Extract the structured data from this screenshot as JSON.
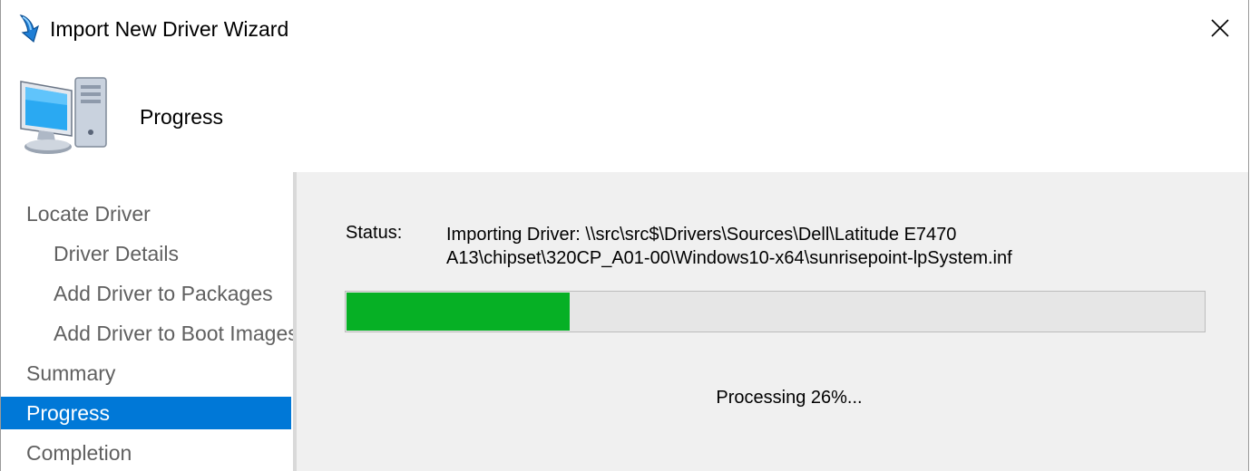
{
  "window": {
    "title": "Import New Driver Wizard",
    "close_label": "Close"
  },
  "header": {
    "title": "Progress"
  },
  "nav": {
    "items": [
      {
        "label": "Locate Driver",
        "level": 0,
        "active": false
      },
      {
        "label": "Driver Details",
        "level": 1,
        "active": false
      },
      {
        "label": "Add Driver to Packages",
        "level": 1,
        "active": false
      },
      {
        "label": "Add Driver to Boot Images",
        "level": 1,
        "active": false
      },
      {
        "label": "Summary",
        "level": 0,
        "active": false
      },
      {
        "label": "Progress",
        "level": 0,
        "active": true
      },
      {
        "label": "Completion",
        "level": 0,
        "active": false
      }
    ]
  },
  "main": {
    "status_label": "Status:",
    "status_line1": "Importing Driver: \\\\src\\src$\\Drivers\\Sources\\Dell\\Latitude E7470",
    "status_line2": "A13\\chipset\\320CP_A01-00\\Windows10-x64\\sunrisepoint-lpSystem.inf",
    "progress_fraction": 0.26,
    "processing_text": "Processing 26%..."
  },
  "colors": {
    "accent": "#0078d7",
    "progress": "#06b025"
  },
  "icons": {
    "app": "blue-arrow-icon",
    "header": "computer-icon",
    "close": "close-icon"
  }
}
